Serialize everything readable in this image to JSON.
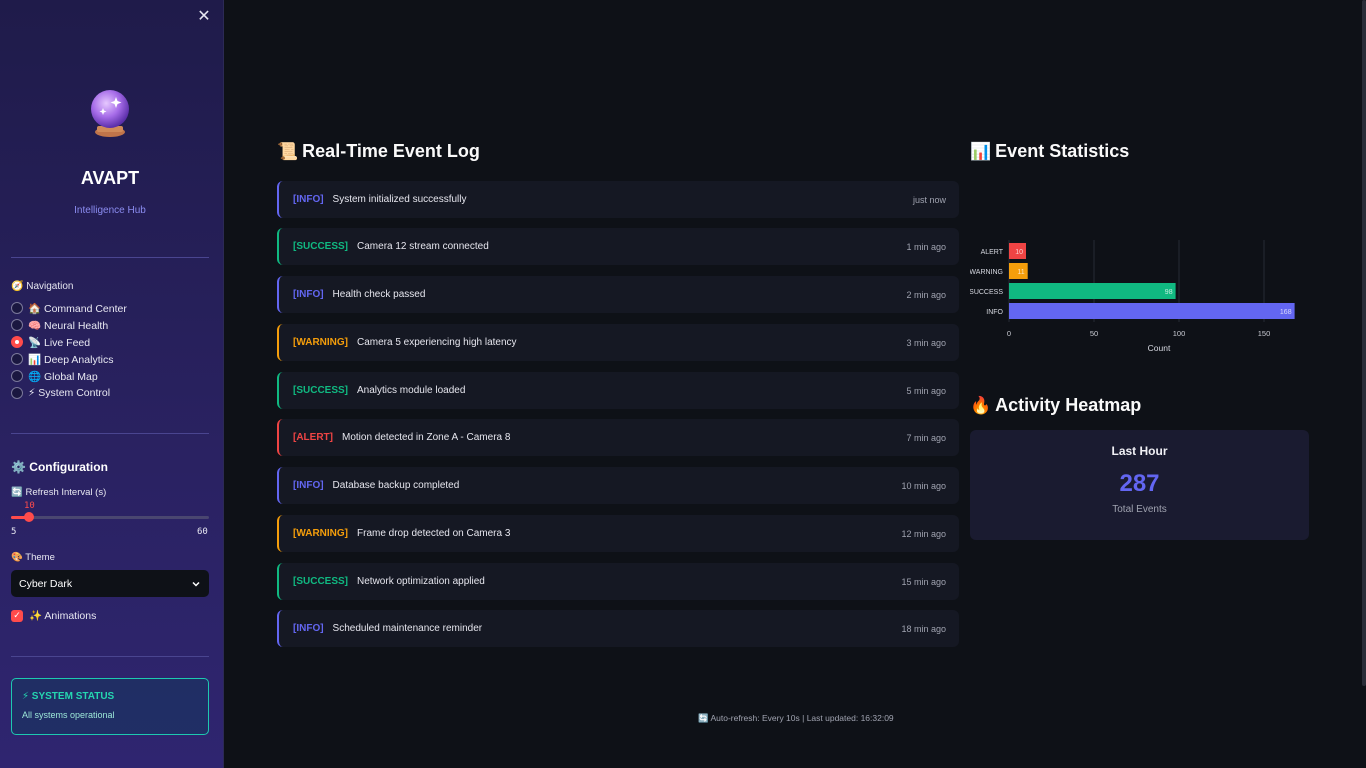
{
  "sidebar": {
    "brand": "AVAPT",
    "subtitle": "Intelligence Hub",
    "nav_title": "🧭 Navigation",
    "nav_items": [
      {
        "label": "🏠 Command Center",
        "selected": false
      },
      {
        "label": "🧠 Neural Health",
        "selected": false
      },
      {
        "label": "📡 Live Feed",
        "selected": true
      },
      {
        "label": "📊 Deep Analytics",
        "selected": false
      },
      {
        "label": "🌐 Global Map",
        "selected": false
      },
      {
        "label": "⚡ System Control",
        "selected": false
      }
    ],
    "config_title": "⚙️ Configuration",
    "refresh_label": "🔄 Refresh Interval (s)",
    "refresh_value": "10",
    "refresh_min": "5",
    "refresh_max": "60",
    "theme_label": "🎨 Theme",
    "theme_value": "Cyber Dark",
    "animations_label": "✨ Animations",
    "animations_checked": true,
    "status_title": "⚡ SYSTEM STATUS",
    "status_text": "All systems operational"
  },
  "event_log": {
    "title": "Real-Time Event Log",
    "icon": "📜",
    "events": [
      {
        "level": "INFO",
        "tag": "[INFO]",
        "message": "System initialized successfully",
        "time": "just now"
      },
      {
        "level": "SUCCESS",
        "tag": "[SUCCESS]",
        "message": "Camera 12 stream connected",
        "time": "1 min ago"
      },
      {
        "level": "INFO",
        "tag": "[INFO]",
        "message": "Health check passed",
        "time": "2 min ago"
      },
      {
        "level": "WARNING",
        "tag": "[WARNING]",
        "message": "Camera 5 experiencing high latency",
        "time": "3 min ago"
      },
      {
        "level": "SUCCESS",
        "tag": "[SUCCESS]",
        "message": "Analytics module loaded",
        "time": "5 min ago"
      },
      {
        "level": "ALERT",
        "tag": "[ALERT]",
        "message": "Motion detected in Zone A - Camera 8",
        "time": "7 min ago"
      },
      {
        "level": "INFO",
        "tag": "[INFO]",
        "message": "Database backup completed",
        "time": "10 min ago"
      },
      {
        "level": "WARNING",
        "tag": "[WARNING]",
        "message": "Frame drop detected on Camera 3",
        "time": "12 min ago"
      },
      {
        "level": "SUCCESS",
        "tag": "[SUCCESS]",
        "message": "Network optimization applied",
        "time": "15 min ago"
      },
      {
        "level": "INFO",
        "tag": "[INFO]",
        "message": "Scheduled maintenance reminder",
        "time": "18 min ago"
      }
    ]
  },
  "stats": {
    "title": "Event Statistics",
    "icon": "📊"
  },
  "chart_data": {
    "type": "bar",
    "orientation": "horizontal",
    "categories": [
      "ALERT",
      "WARNING",
      "SUCCESS",
      "INFO"
    ],
    "values": [
      10,
      11,
      98,
      168
    ],
    "colors": [
      "#ef4444",
      "#f59e0b",
      "#10b981",
      "#6366f1"
    ],
    "xlabel": "Count",
    "ylabel": "",
    "xticks": [
      0,
      50,
      100,
      150
    ],
    "xlim": [
      0,
      175
    ],
    "grid": true
  },
  "heatmap": {
    "title": "Activity Heatmap",
    "icon": "🔥",
    "card_title": "Last Hour",
    "value": "287",
    "caption": "Total Events"
  },
  "footer": {
    "text": "🔄 Auto-refresh: Every 10s | Last updated: 16:32:09"
  },
  "colors": {
    "accent": "#6366f1",
    "success": "#10b981",
    "warning": "#f59e0b",
    "alert": "#ef4444",
    "primary": "#ff4b4b"
  }
}
